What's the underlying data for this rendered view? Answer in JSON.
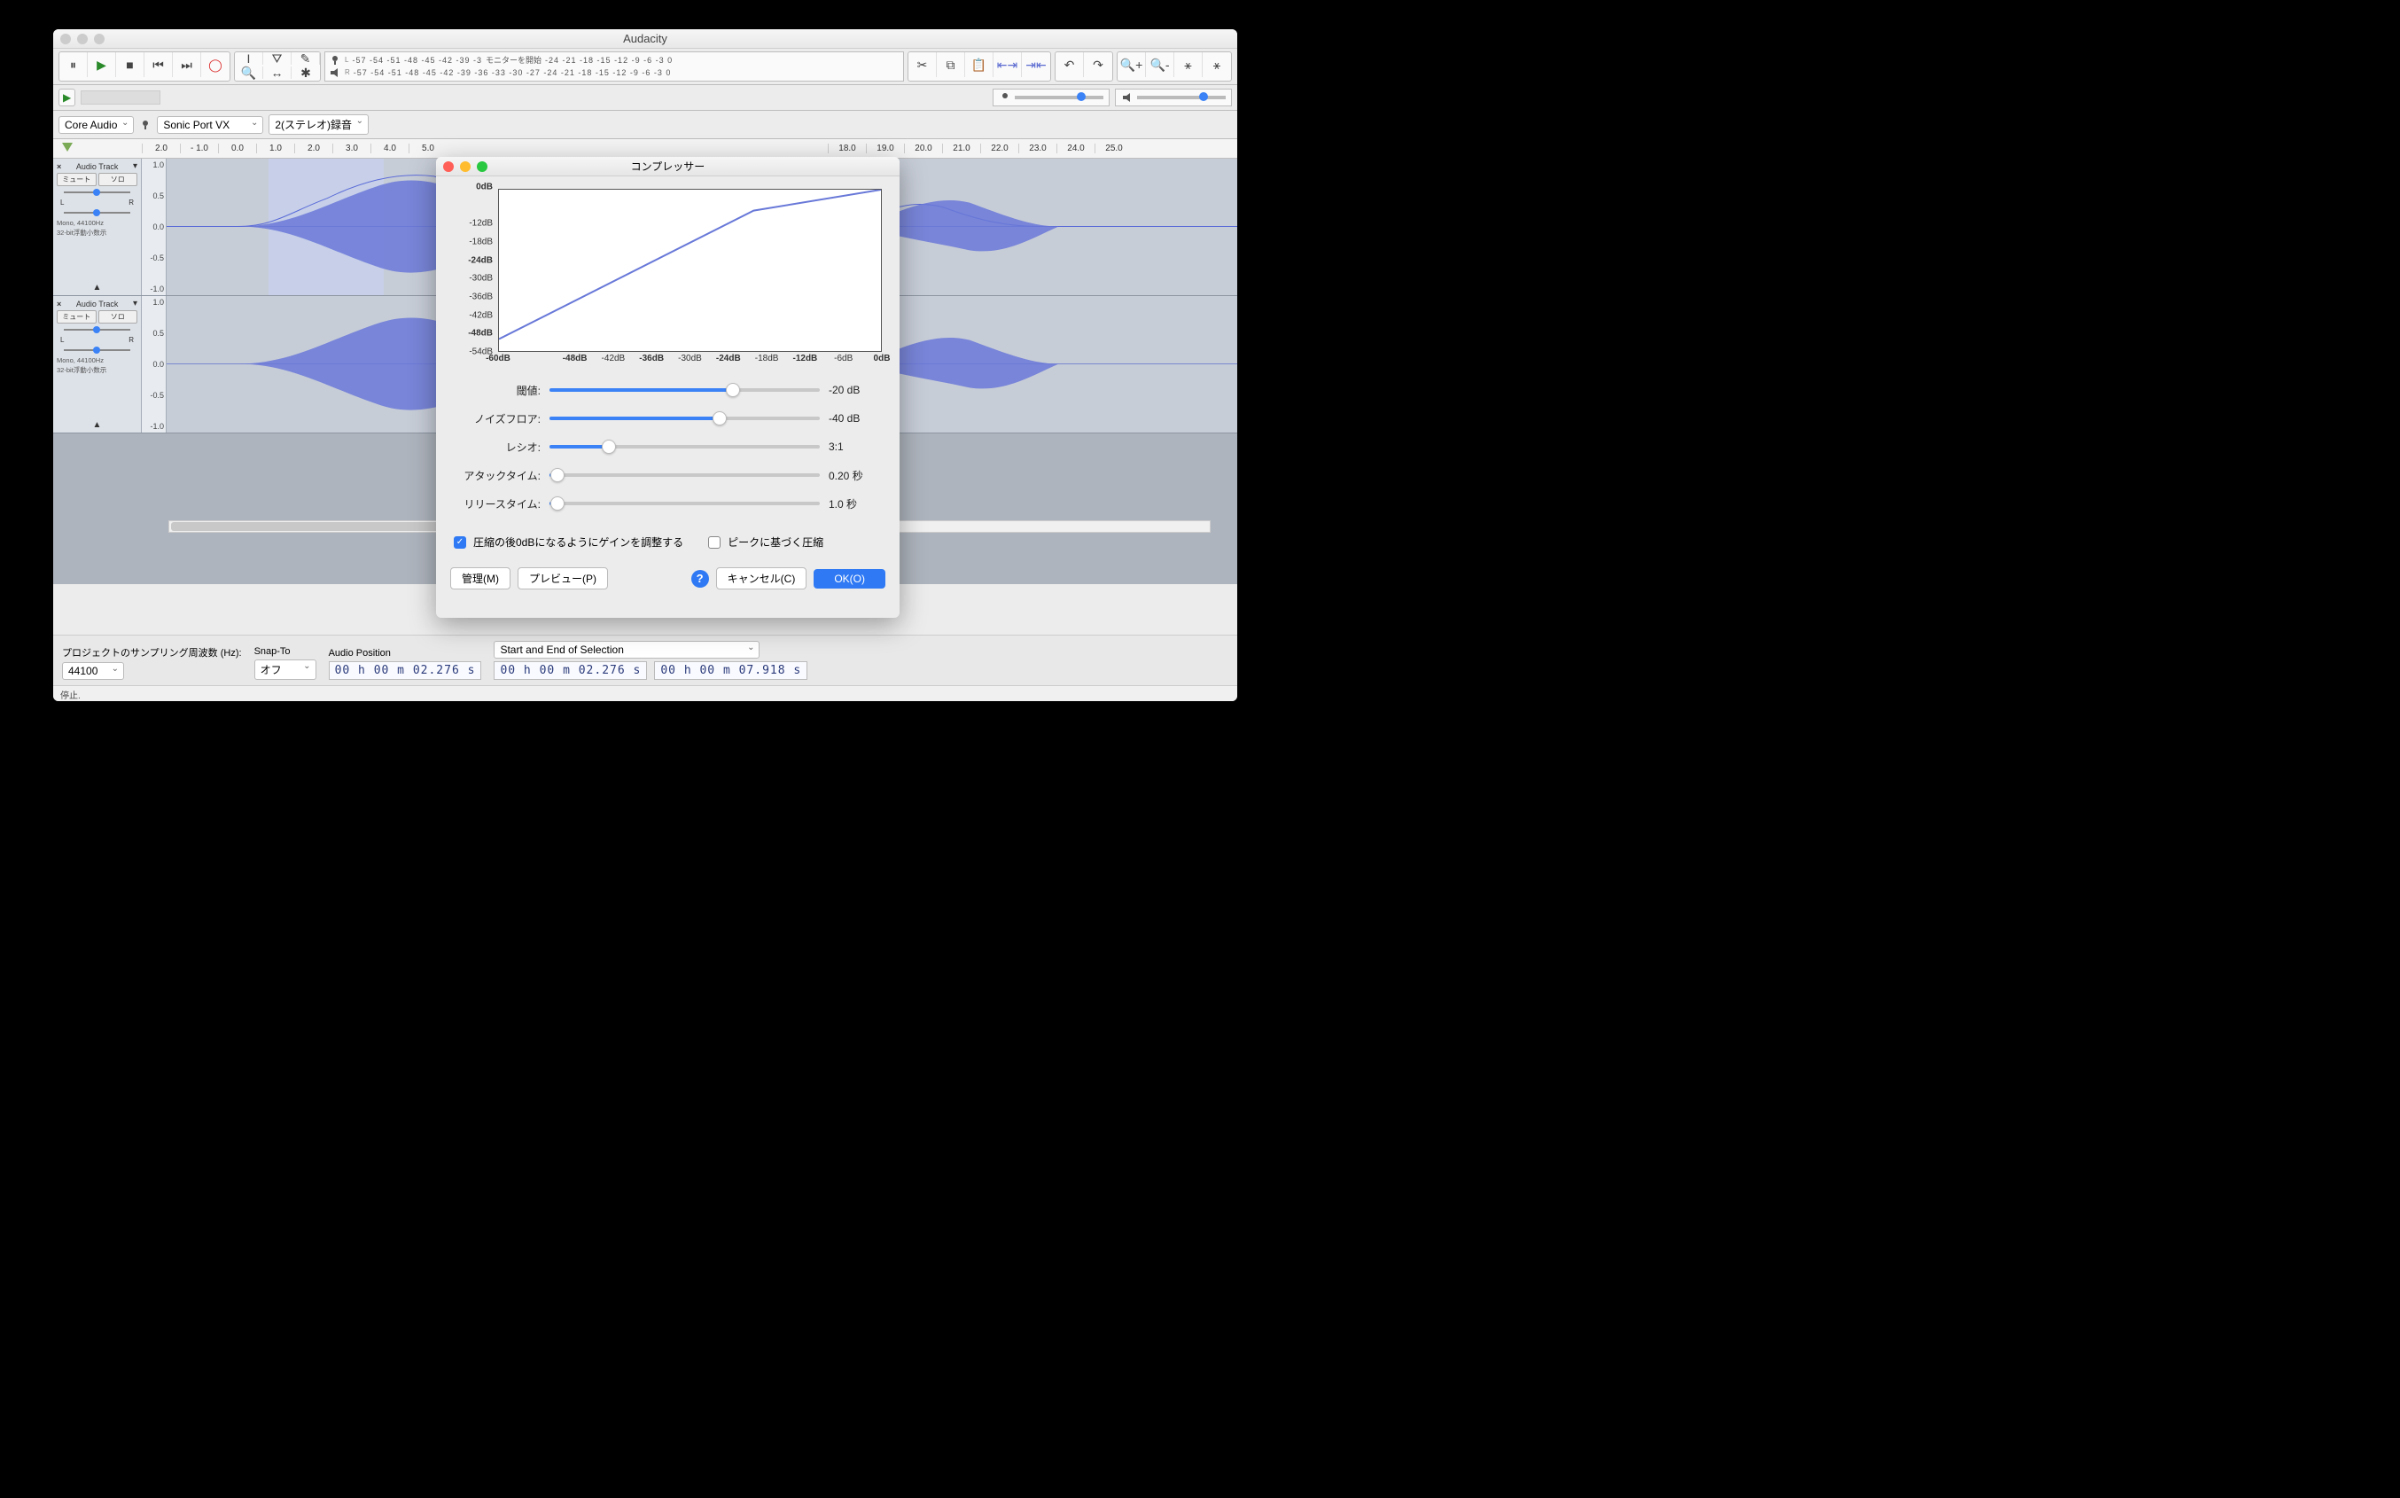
{
  "app": {
    "title": "Audacity"
  },
  "traffic": {
    "close": "close",
    "min": "minimize",
    "max": "maximize"
  },
  "transport": {
    "pause": "⏸",
    "play": "▶",
    "stop": "■",
    "skip_start": "⏮",
    "skip_end": "⏭",
    "record": "●"
  },
  "meter": {
    "monitor_label": "モニターを開始",
    "ticks": "-57 -54 -51 -48 -45 -42 -39 -36 -33 -30 -27 -24 -21 -18 -15 -12 -9 -6 -3 0",
    "L": "L",
    "R": "R"
  },
  "devicebar": {
    "host": "Core Audio",
    "rec_device": "Sonic Port VX",
    "channels": "2(ステレオ)録音"
  },
  "ruler": [
    "2.0",
    "- 1.0",
    "0.0",
    "1.0",
    "2.0",
    "3.0",
    "4.0",
    "5.0",
    "",
    "",
    "",
    "",
    "",
    "",
    "",
    "",
    "",
    "",
    "18.0",
    "19.0",
    "20.0",
    "21.0",
    "22.0",
    "23.0",
    "24.0",
    "25.0"
  ],
  "track": {
    "name": "Audio Track",
    "mute": "ミュート",
    "solo": "ソロ",
    "L": "L",
    "R": "R",
    "info1": "Mono, 44100Hz",
    "info2": "32-bit浮動小数示",
    "scale": [
      "1.0",
      "0.5",
      "0.0",
      "-0.5",
      "-1.0"
    ]
  },
  "dialog": {
    "title": "コンプレッサー",
    "threshold_label": "閾値:",
    "threshold_val": "-20 dB",
    "noisefloor_label": "ノイズフロア:",
    "noisefloor_val": "-40 dB",
    "ratio_label": "レシオ:",
    "ratio_val": "3:1",
    "attack_label": "アタックタイム:",
    "attack_val": "0.20 秒",
    "release_label": "リリースタイム:",
    "release_val": "1.0 秒",
    "makeup_gain": "圧縮の後0dBになるようにゲインを調整する",
    "peak_compress": "ピークに基づく圧縮",
    "manage": "管理(M)",
    "preview": "プレビュー(P)",
    "cancel": "キャンセル(C)",
    "ok": "OK(O)"
  },
  "chart_data": {
    "type": "line",
    "title": "",
    "xlabel": "",
    "ylabel": "",
    "xlim": [
      -60,
      0
    ],
    "ylim": [
      -54,
      0
    ],
    "x_ticks": [
      "-60dB",
      "",
      "-48dB",
      "-42dB",
      "-36dB",
      "-30dB",
      "-24dB",
      "-18dB",
      "-12dB",
      "-6dB",
      "0dB"
    ],
    "x_tick_vals": [
      -60,
      -54,
      -48,
      -42,
      -36,
      -30,
      -24,
      -18,
      -12,
      -6,
      0
    ],
    "x_bold": [
      -60,
      -48,
      -36,
      -24,
      -12,
      0
    ],
    "y_ticks": [
      "0dB",
      "-12dB",
      "-18dB",
      "-24dB",
      "-30dB",
      "-36dB",
      "-42dB",
      "-48dB",
      "-54dB"
    ],
    "y_tick_vals": [
      0,
      -12,
      -18,
      -24,
      -30,
      -36,
      -42,
      -48,
      -54
    ],
    "y_bold": [
      0,
      -24,
      -48
    ],
    "series": [
      {
        "name": "transfer",
        "points": [
          [
            -60,
            -50
          ],
          [
            -20,
            -7
          ],
          [
            0,
            0
          ]
        ]
      }
    ]
  },
  "bottom": {
    "proj_rate_label": "プロジェクトのサンプリング周波数 (Hz):",
    "proj_rate": "44100",
    "snap_label": "Snap-To",
    "snap_val": "オフ",
    "audio_pos_label": "Audio Position",
    "audio_pos": "00 h 00 m 02.276 s",
    "sel_label": "Start and End of Selection",
    "sel_start": "00 h 00 m 02.276 s",
    "sel_end": "00 h 00 m 07.918 s"
  },
  "status": "停止."
}
